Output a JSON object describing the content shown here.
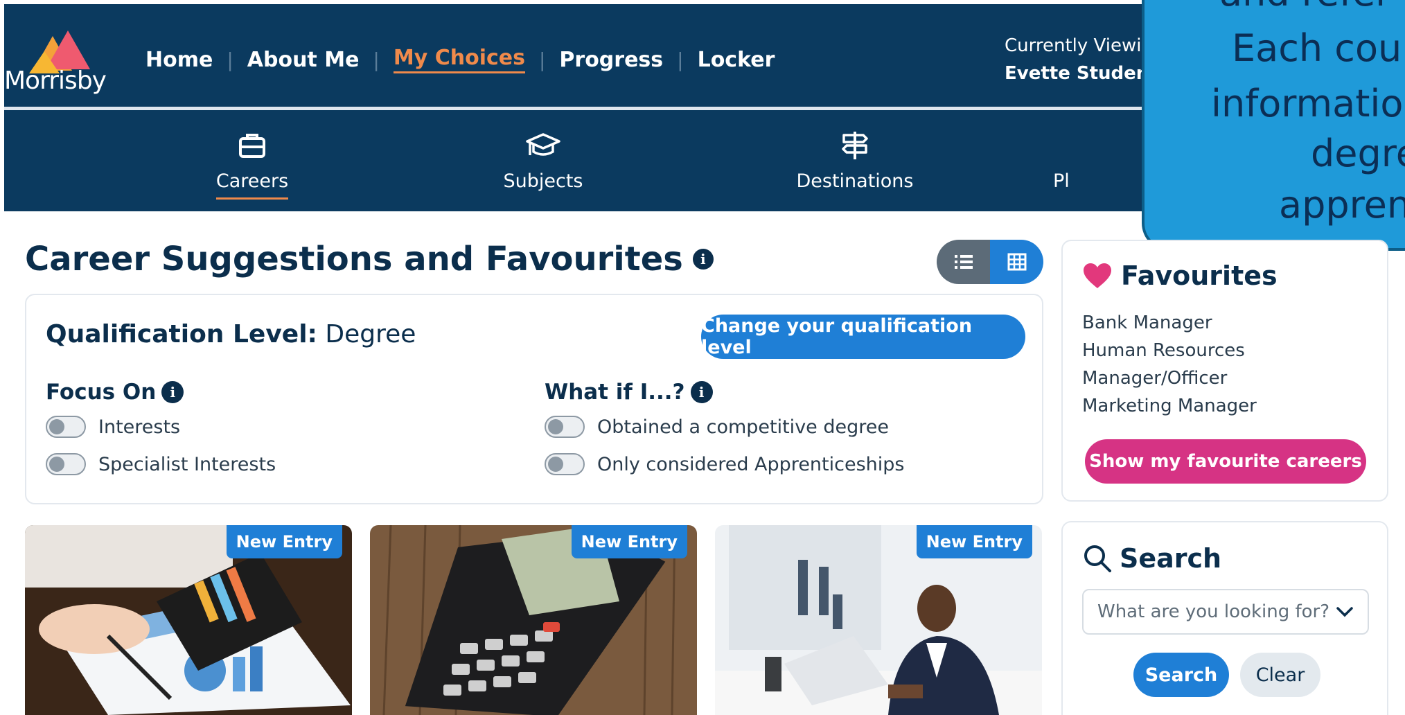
{
  "brand": {
    "name": "Morrisby"
  },
  "nav": {
    "items": [
      {
        "label": "Home"
      },
      {
        "label": "About Me"
      },
      {
        "label": "My Choices",
        "active": true
      },
      {
        "label": "Progress"
      },
      {
        "label": "Locker"
      }
    ]
  },
  "viewing": {
    "label": "Currently Viewi",
    "name": "Evette Student"
  },
  "subnav": {
    "items": [
      {
        "label": "Careers",
        "icon": "briefcase-icon",
        "active": true
      },
      {
        "label": "Subjects",
        "icon": "graduation-cap-icon"
      },
      {
        "label": "Destinations",
        "icon": "signpost-icon"
      },
      {
        "label": "Pl"
      }
    ]
  },
  "tooltip": {
    "lines": [
      "and refer b",
      "Each cour",
      "informatio",
      "degre",
      "apprent"
    ]
  },
  "main": {
    "title": "Career Suggestions and Favourites",
    "info_glyph": "i"
  },
  "qualification": {
    "label": "Qualification Level:",
    "value": "Degree",
    "change_button": "Change your qualification level",
    "focus_on": {
      "title": "Focus On",
      "toggles": [
        {
          "label": "Interests",
          "on": false
        },
        {
          "label": "Specialist Interests",
          "on": false
        }
      ]
    },
    "what_if": {
      "title": "What if I...?",
      "toggles": [
        {
          "label": "Obtained a competitive degree",
          "on": false
        },
        {
          "label": "Only considered Apprenticeships",
          "on": false
        }
      ]
    }
  },
  "cards": [
    {
      "badge": "New Entry"
    },
    {
      "badge": "New Entry"
    },
    {
      "badge": "New Entry"
    }
  ],
  "favourites": {
    "title": "Favourites",
    "items": [
      "Bank Manager",
      "Human Resources",
      "Manager/Officer",
      "Marketing Manager"
    ],
    "button": "Show my favourite careers"
  },
  "search": {
    "title": "Search",
    "placeholder": "What are you looking for?",
    "search_button": "Search",
    "clear_button": "Clear"
  },
  "colors": {
    "navy": "#0b3a5f",
    "accent_orange": "#f08a4b",
    "primary_blue": "#1f7fd6",
    "pink": "#d63384",
    "tooltip_blue": "#1f9ad9"
  }
}
